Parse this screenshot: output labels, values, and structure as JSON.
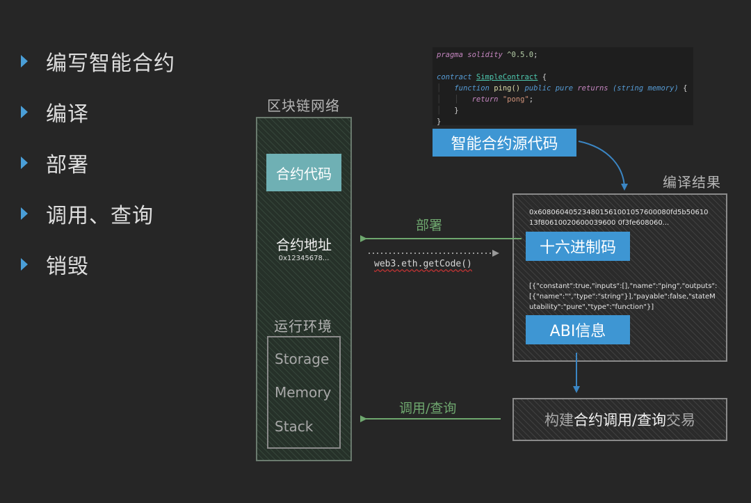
{
  "bullets": [
    "编写智能合约",
    "编译",
    "部署",
    "调用、查询",
    "销毁"
  ],
  "blockchain": {
    "title": "区块链网络",
    "contract_code_label": "合约代码",
    "contract_address_label": "合约地址",
    "contract_address_value": "0x12345678...",
    "runtime_title": "运行环境",
    "runtime_items": [
      "Storage",
      "Memory",
      "Stack"
    ]
  },
  "source": {
    "code": {
      "pragma_kw": "pragma",
      "pragma_name": "solidity",
      "pragma_version": "^0.5.0",
      "contract_kw": "contract",
      "contract_name": "SimpleContract",
      "function_kw": "function",
      "function_name": "ping()",
      "mod_public": "public",
      "mod_pure": "pure",
      "returns_kw": "returns",
      "returns_type": "(string memory)",
      "return_kw": "return",
      "return_value": "\"pong\""
    },
    "label": "智能合约源代码"
  },
  "compile_result": {
    "title": "编译结果",
    "bytecode_lines": [
      "0x6080604052348015610010576000 80fd5b50610",
      "13f80610020600039600 0f3fe608060..."
    ],
    "bytecode_line1": "0x608060405234801561001057600080fd5b50610",
    "bytecode_line2": "13f80610020600039600 0f3fe608060...",
    "hex_label": "十六进制码",
    "abi_lines": [
      "[{\"constant\":true,\"inputs\":[],\"name\":\"ping\",\"outputs\":",
      "[{\"name\":\"\",\"type\":\"string\"}],\"payable\":false,\"stateM",
      "utability\":\"pure\",\"type\":\"function\"}]"
    ],
    "abi_label": "ABI信息"
  },
  "arrows": {
    "deploy_label": "部署",
    "getcode_label": "web3.eth.getCode()",
    "call_label": "调用/查询"
  },
  "build_tx": {
    "part1": "构建",
    "part2": "合约调用/查询",
    "part3": "交易"
  },
  "colors": {
    "accent_blue": "#3e96d3",
    "teal": "#6fb0b4",
    "green": "#6fa86f",
    "arrow_blue": "#3b86c4"
  }
}
